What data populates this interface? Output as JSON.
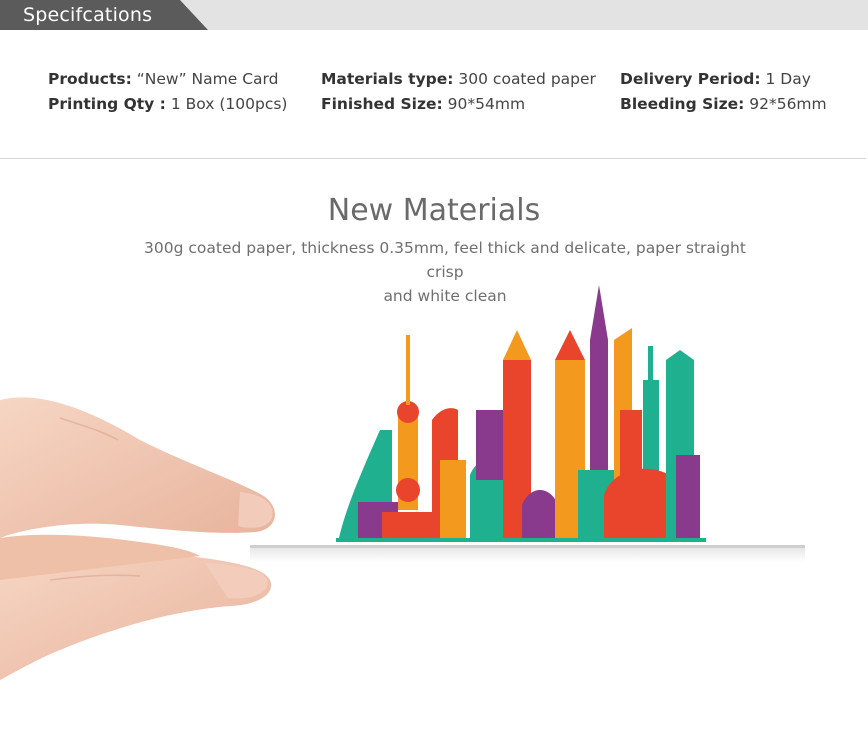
{
  "header": {
    "title": "Specifcations"
  },
  "specs": {
    "products_label": "Products:",
    "products_value": "“New” Name Card",
    "printing_qty_label": "Printing Qty :",
    "printing_qty_value": "1 Box (100pcs)",
    "materials_type_label": "Materials type:",
    "materials_type_value": "300 coated paper",
    "finished_size_label": "Finished Size:",
    "finished_size_value": "90*54mm",
    "delivery_label": "Delivery Period:",
    "delivery_value": "1 Day",
    "bleeding_label": "Bleeding Size:",
    "bleeding_value": "92*56mm"
  },
  "section": {
    "title": "New Materials",
    "description_line1": "300g coated paper, thickness 0.35mm, feel thick and delicate, paper straight crisp",
    "description_line2": "and white clean"
  },
  "colors": {
    "header_tab": "#5b5b5b",
    "header_band": "#e3e3e3",
    "skin": "#f2c9b3",
    "skyline_red": "#e8452c",
    "skyline_orange": "#f39a1e",
    "skyline_teal": "#1fb08f",
    "skyline_purple": "#8a3a8c"
  }
}
